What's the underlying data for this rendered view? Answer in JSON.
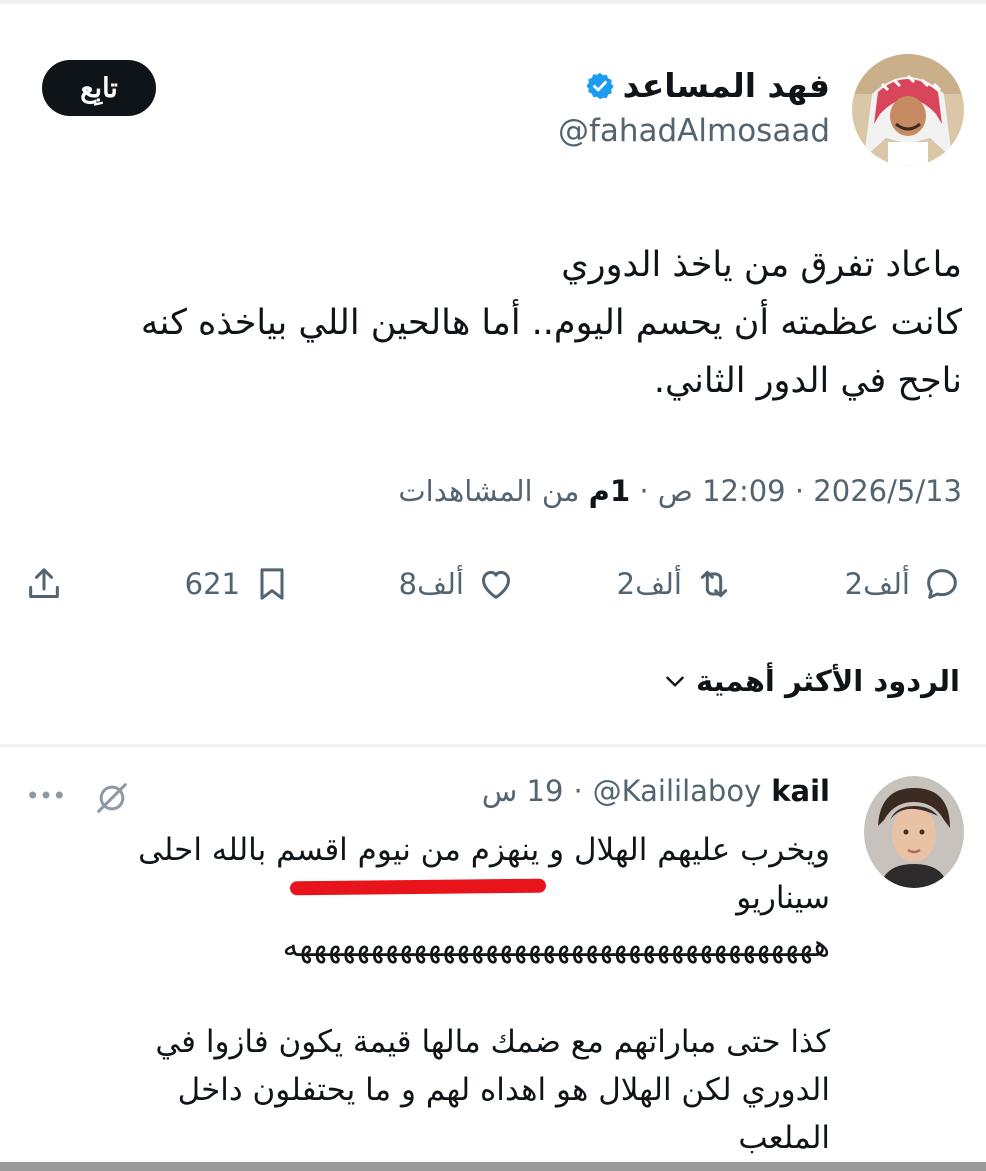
{
  "tweet": {
    "author_name": "فهد المساعد",
    "author_handle": "@fahadAlmosaad",
    "verified_icon": "verified-badge-icon",
    "follow_label": "تابِع",
    "text_lines": [
      "ماعاد تفرق من ياخذ الدوري",
      "كانت عظمته أن يحسم اليوم.. أما هالحين اللي بياخذه كنه",
      "ناجح في الدور الثاني."
    ],
    "date": "2026/5/13",
    "time": "12:09 ص",
    "views_count": "1م",
    "views_label": "من المشاهدات",
    "separator": "·"
  },
  "actions": {
    "replies": "2ألف",
    "retweets": "2ألف",
    "likes": "8ألف",
    "bookmarks": "621"
  },
  "replies_header": "الردود الأكثر أهمية",
  "reply": {
    "name": "kail",
    "handle": "@Kaililaboy",
    "time": "19 س",
    "separator": "·",
    "text_lines": [
      "ويخرب عليهم الهلال و ينهزم من نيوم اقسم بالله احلى",
      "سيناريو",
      "هههههههههههههههههههههههههههههههههههههه",
      "",
      "كذا حتى مباراتهم مع ضمك مالها قيمة يكون فازوا في",
      "الدوري لكن الهلال هو اهداه لهم و ما يحتفلون داخل",
      "الملعب"
    ]
  },
  "colors": {
    "text": "#0f1419",
    "muted": "#536471",
    "verified": "#1d9bf0",
    "follow_bg": "#0f1419",
    "highlight": "#e8131b"
  }
}
